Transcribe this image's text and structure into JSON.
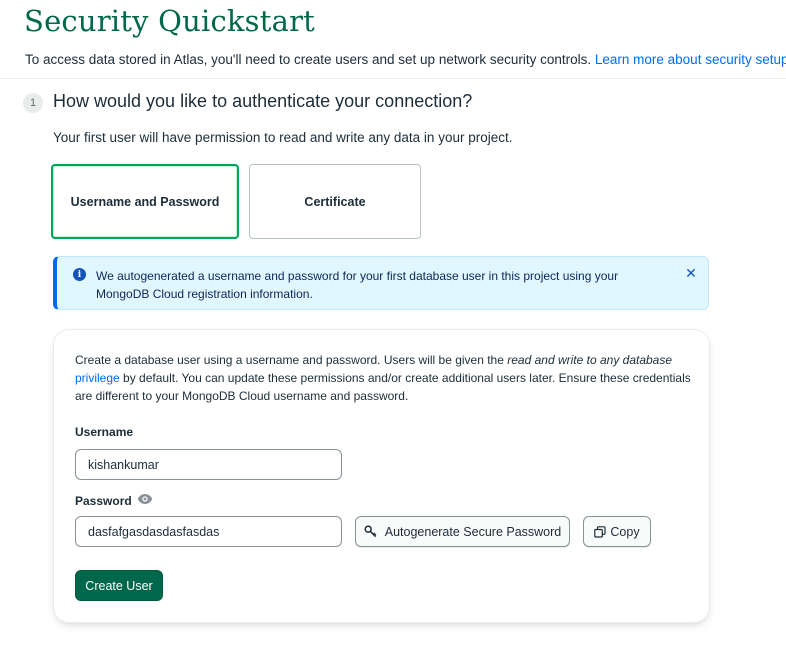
{
  "page": {
    "title": "Security Quickstart",
    "intro_text": "To access data stored in Atlas, you'll need to create users and set up network security controls. ",
    "intro_link": "Learn more about security setup"
  },
  "step": {
    "number": "1",
    "heading": "How would you like to authenticate your connection?",
    "subtext": "Your first user will have permission to read and write any data in your project."
  },
  "auth_options": {
    "userpass_label": "Username and Password",
    "cert_label": "Certificate",
    "selected": "Username and Password"
  },
  "callout": {
    "text": "We autogenerated a username and password for your first database user in this project using your MongoDB Cloud registration information.",
    "icon": "info-icon",
    "close_icon": "close-icon"
  },
  "form": {
    "desc_part1": "Create a database user using a username and password. Users will be given the ",
    "desc_italic": "read and write to any database",
    "desc_link": "privilege",
    "desc_part2": " by default. You can update these permissions and/or create additional users later. Ensure these credentials are different to your MongoDB Cloud username and password.",
    "username_label": "Username",
    "username_value": "kishankumar",
    "password_label": "Password",
    "password_value": "dasfafgasdasdasfasdas",
    "autogen_label": "Autogenerate Secure Password",
    "copy_label": "Copy",
    "create_label": "Create User"
  },
  "colors": {
    "brand_green": "#00684a",
    "selected_border": "#00a35c",
    "link_blue": "#016bf8",
    "callout_bg": "#e1f7ff"
  }
}
